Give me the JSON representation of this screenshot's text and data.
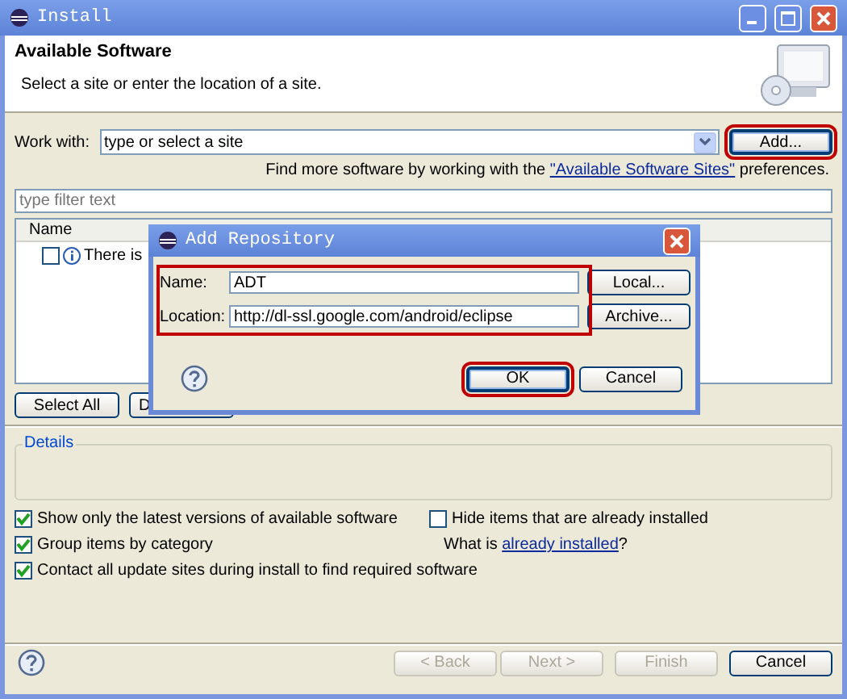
{
  "window": {
    "title": "Install"
  },
  "header": {
    "title": "Available Software",
    "subtitle": "Select a site or enter the location of a site."
  },
  "work_with": {
    "label": "Work with:",
    "placeholder": "type or select a site",
    "add_button": {
      "label": "Add...",
      "highlighted": true
    }
  },
  "hint": {
    "before": "Find more software by working with the ",
    "link": "\"Available Software Sites\"",
    "after": " preferences."
  },
  "filter": {
    "placeholder": "type filter text"
  },
  "tree": {
    "column": "Name",
    "rows": [
      {
        "label": "There is",
        "checked": false
      }
    ]
  },
  "tree_buttons": [
    "Select All",
    "D"
  ],
  "details": {
    "title": "Details"
  },
  "options": [
    {
      "label": "Show only the latest versions of available software",
      "checked": true
    },
    {
      "label": "Hide items that are already installed",
      "checked": false
    },
    {
      "label": "Group items by category",
      "checked": true
    },
    {
      "label": "Contact all update sites during install to find required software",
      "checked": true
    }
  ],
  "installed_note": {
    "before": "What is ",
    "link": "already installed",
    "after": "?"
  },
  "footer_buttons": [
    {
      "label": "< Back",
      "disabled": true
    },
    {
      "label": "Next >",
      "disabled": true
    },
    {
      "label": "Finish",
      "disabled": true
    },
    {
      "label": "Cancel",
      "disabled": false
    }
  ],
  "dialog": {
    "title": "Add Repository",
    "fields_highlighted": true,
    "fields": [
      {
        "label": "Name:",
        "value": "ADT",
        "button": "Local..."
      },
      {
        "label": "Location:",
        "value": "http://dl-ssl.google.com/android/eclipse",
        "button": "Archive..."
      }
    ],
    "buttons": [
      {
        "label": "OK",
        "highlighted": true
      },
      {
        "label": "Cancel",
        "highlighted": false
      }
    ]
  }
}
